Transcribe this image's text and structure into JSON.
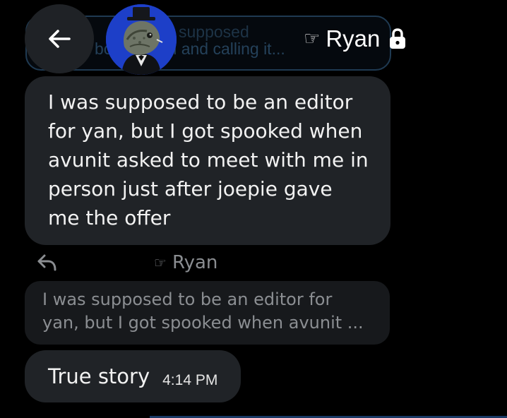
{
  "background_context": {
    "line1": "supposed",
    "line2": "box fir Neal and calling it..."
  },
  "header": {
    "contact_name": "Ryan",
    "pointing_glyph": "☞"
  },
  "messages": {
    "main_message": "I was supposed to be an editor for yan, but I got spooked when avunit asked to meet with me in person just after joepie gave me the offer",
    "reply_to_name": "Ryan",
    "reply_to_glyph": "☞",
    "quoted_text": "I was supposed to be an editor for yan, but I got spooked when avunit ...",
    "reply_text": "True story",
    "reply_time": "4:14 PM"
  },
  "icons": {
    "back": "back-arrow-icon",
    "lock": "lock-icon",
    "reply": "reply-arrow-icon",
    "avatar": "avatar-iguana-top-hat"
  },
  "colors": {
    "background": "#000000",
    "bubble": "#202327",
    "quote_bubble": "#17191c",
    "muted_text": "#8a8d91",
    "accent_blue": "#1d3fc8"
  }
}
